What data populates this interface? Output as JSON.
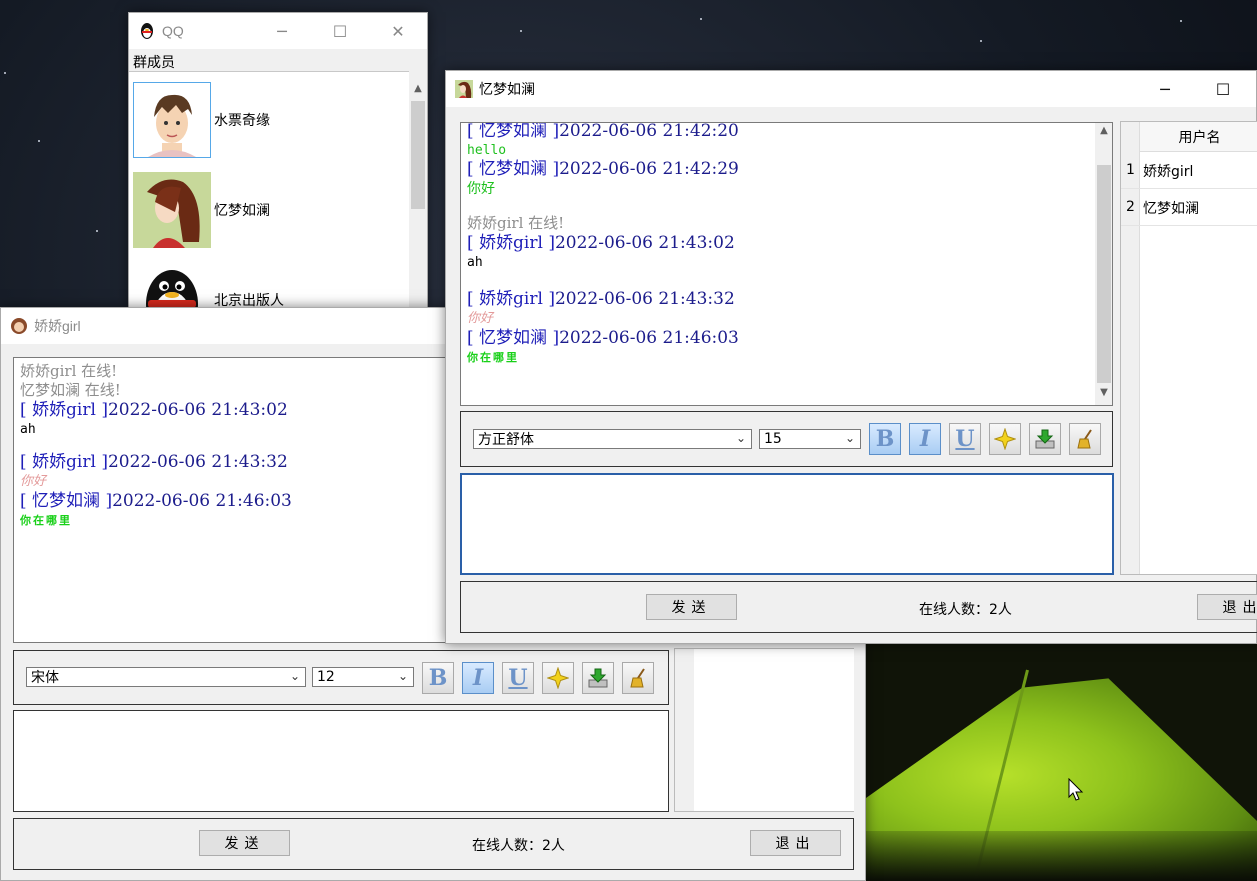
{
  "colors": {
    "header_blue": "#1f1fb8",
    "system_gray": "#8e8e8e",
    "green_msg": "#1ec01e",
    "pink_msg": "#e39a9a",
    "bright_green": "#18e018"
  },
  "qq_window": {
    "title": "QQ",
    "section_label": "群成员",
    "members": [
      {
        "name": "水票奇缘",
        "avatar_icon": "boy-avatar-icon"
      },
      {
        "name": "忆梦如澜",
        "avatar_icon": "girl-long-hair-avatar-icon"
      },
      {
        "name": "北京出版人",
        "avatar_icon": "penguin-avatar-icon"
      }
    ]
  },
  "chat_jiaojiao": {
    "title": "娇娇girl",
    "log": {
      "sys1": "娇娇girl 在线!",
      "sys2": "忆梦如澜 在线!",
      "m1_open": "[ ",
      "m1_name": "娇娇girl",
      "m1_close": " ]",
      "m1_time": "2022-06-06 21:43:02",
      "m1_body": "ah",
      "m2_open": "[ ",
      "m2_name": "娇娇girl",
      "m2_close": " ]",
      "m2_time": "2022-06-06 21:43:32",
      "m2_body": "你好",
      "m3_open": "[ ",
      "m3_name": "忆梦如澜",
      "m3_close": " ]",
      "m3_time": "2022-06-06 21:46:03",
      "m3_body": "你在哪里"
    },
    "font_select": "宋体",
    "size_select": "12",
    "send_label": "发送",
    "online_label": "在线人数：2人",
    "exit_label": "退出"
  },
  "chat_yimeng": {
    "title": "忆梦如澜",
    "log": {
      "m0_open": "[ ",
      "m0_name": "忆梦如澜",
      "m0_close": " ]",
      "m0_time": "2022-06-06 21:42:20",
      "m0_body": "hello",
      "m1_open": "[ ",
      "m1_name": "忆梦如澜",
      "m1_close": " ]",
      "m1_time": "2022-06-06 21:42:29",
      "m1_body": "你好",
      "sys1": "娇娇girl 在线!",
      "m2_open": "[ ",
      "m2_name": "娇娇girl",
      "m2_close": " ]",
      "m2_time": "2022-06-06 21:43:02",
      "m2_body": "ah",
      "m3_open": "[ ",
      "m3_name": "娇娇girl",
      "m3_close": " ]",
      "m3_time": "2022-06-06 21:43:32",
      "m3_body": "你好",
      "m4_open": "[ ",
      "m4_name": "忆梦如澜",
      "m4_close": " ]",
      "m4_time": "2022-06-06 21:46:03",
      "m4_body": "你在哪里"
    },
    "font_select": "方正舒体",
    "size_select": "15",
    "send_label": "发送",
    "online_label": "在线人数：2人",
    "exit_label": "退出",
    "user_table": {
      "header": "用户名",
      "rows": [
        {
          "index": "1",
          "name": "娇娇girl"
        },
        {
          "index": "2",
          "name": "忆梦如澜"
        }
      ]
    }
  },
  "toolbar_icons": [
    "bold-icon",
    "italic-icon",
    "underline-icon",
    "color-star-icon",
    "save-download-icon",
    "clear-broom-icon"
  ],
  "toolbar_text": {
    "bold": "B",
    "italic": "I",
    "underline": "U"
  }
}
